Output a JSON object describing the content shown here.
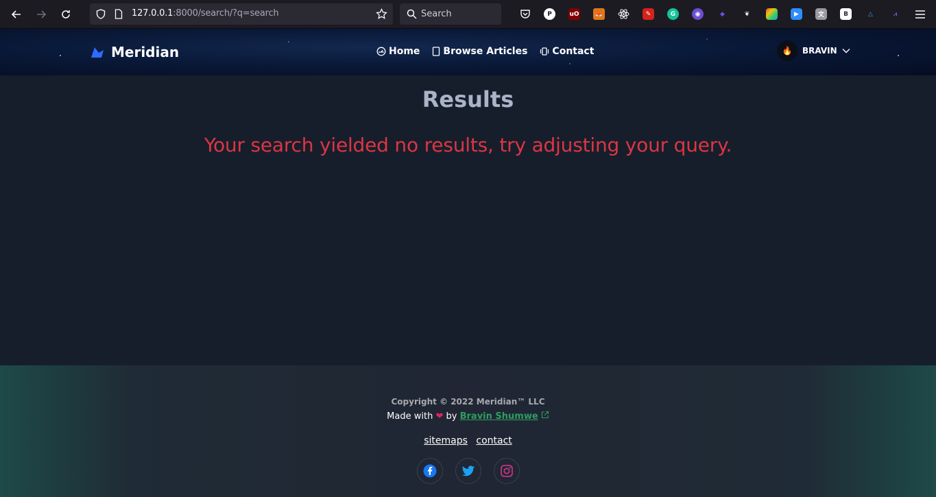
{
  "browser": {
    "url_host": "127.0.0.1",
    "url_rest": ":8000/search/?q=search",
    "search_placeholder": "Search"
  },
  "header": {
    "brand": "Meridian",
    "nav": {
      "home": "Home",
      "browse": "Browse Articles",
      "contact": "Contact"
    },
    "user": {
      "name": "BRAVIN",
      "avatar_icon": "fire-icon"
    }
  },
  "main": {
    "title": "Results",
    "message": "Your search yielded no results, try adjusting your query."
  },
  "footer": {
    "copyright": "Copyright © 2022 Meridian™  LLC",
    "made_with_prefix": "Made with",
    "made_with_by": "by",
    "author": "Bravin Shumwe",
    "links": {
      "sitemaps": "sitemaps",
      "contact": "contact"
    },
    "socials": [
      "facebook-icon",
      "twitter-icon",
      "instagram-icon"
    ]
  },
  "colors": {
    "error": "#dc3545",
    "author_link": "#2e9d62",
    "facebook": "#1877f2",
    "twitter": "#1da1f2",
    "instagram": "#c13584"
  }
}
